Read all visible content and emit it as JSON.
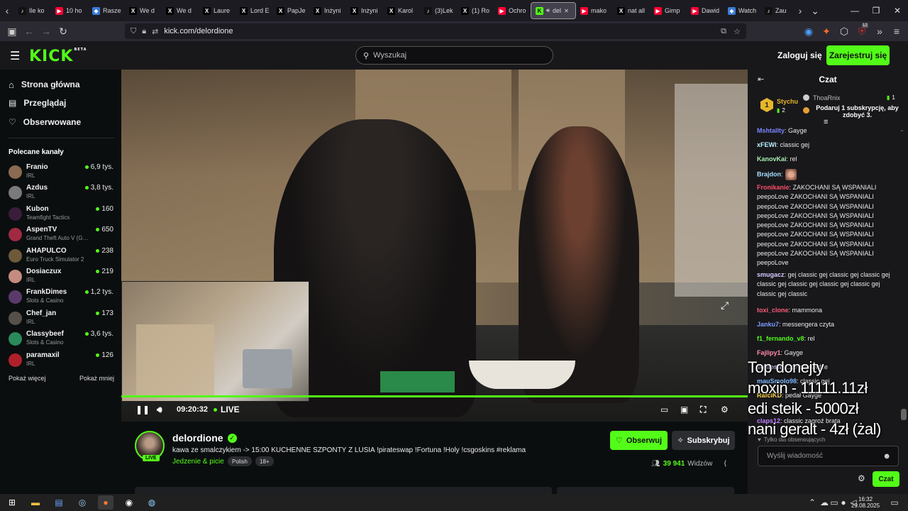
{
  "browser": {
    "tabs": [
      {
        "label": "Ile ko",
        "icon": "tiktok-icon",
        "color": "#111111"
      },
      {
        "label": "10 ho",
        "icon": "youtube-icon",
        "color": "#ff0033"
      },
      {
        "label": "Rasze",
        "icon": "bookmark-icon",
        "color": "#3a7bd5"
      },
      {
        "label": "We d",
        "icon": "x-icon",
        "color": "#000000"
      },
      {
        "label": "We d",
        "icon": "x-icon",
        "color": "#000000"
      },
      {
        "label": "Laure",
        "icon": "x-icon",
        "color": "#000000"
      },
      {
        "label": "Lord E",
        "icon": "x-icon",
        "color": "#000000"
      },
      {
        "label": "PapJe",
        "icon": "x-icon",
        "color": "#000000"
      },
      {
        "label": "Inżyni",
        "icon": "x-icon",
        "color": "#000000"
      },
      {
        "label": "Inżyni",
        "icon": "x-icon",
        "color": "#000000"
      },
      {
        "label": "Karol",
        "icon": "x-icon",
        "color": "#000000"
      },
      {
        "label": "(3)Lek",
        "icon": "tiktok-icon",
        "color": "#111111"
      },
      {
        "label": "(1) Ro",
        "icon": "x-icon",
        "color": "#000000"
      },
      {
        "label": "Ochro",
        "icon": "youtube-icon",
        "color": "#ff0033"
      },
      {
        "label": "del",
        "icon": "kick-icon",
        "color": "#53fc18",
        "active": true
      },
      {
        "label": "mako",
        "icon": "youtube-icon",
        "color": "#ff0033"
      },
      {
        "label": "nat all",
        "icon": "x-icon",
        "color": "#000000"
      },
      {
        "label": "Gimp",
        "icon": "youtube-icon",
        "color": "#ff0033"
      },
      {
        "label": "Dawid",
        "icon": "youtube-icon",
        "color": "#ff0033"
      },
      {
        "label": "Watch",
        "icon": "bookmark-icon",
        "color": "#3a7bd5"
      },
      {
        "label": "Zau",
        "icon": "tiktok-icon",
        "color": "#111111"
      }
    ],
    "url": "kick.com/delordione"
  },
  "header": {
    "logo": "KICK",
    "logo_beta": "BETA",
    "search_placeholder": "Wyszukaj",
    "login": "Zaloguj się",
    "register": "Zarejestruj się"
  },
  "sidebar": {
    "nav": [
      {
        "label": "Strona główna",
        "icon": "home-icon"
      },
      {
        "label": "Przeglądaj",
        "icon": "browse-icon"
      },
      {
        "label": "Obserwowane",
        "icon": "heart-icon"
      }
    ],
    "recommended_title": "Polecane kanały",
    "channels": [
      {
        "name": "Franio",
        "category": "IRL",
        "viewers": "6,9 tys.",
        "color": "#8a6a50"
      },
      {
        "name": "Azdus",
        "category": "IRL",
        "viewers": "3,8 tys.",
        "color": "#7a7a7a"
      },
      {
        "name": "Kubon",
        "category": "Teamfight Tactics",
        "viewers": "160",
        "color": "#3a1d3a"
      },
      {
        "name": "AspenTV",
        "category": "Grand Theft Auto V (G…",
        "viewers": "650",
        "color": "#a02a40"
      },
      {
        "name": "AHAPULCO",
        "category": "Euro Truck Simulator 2",
        "viewers": "238",
        "color": "#6d5a3a"
      },
      {
        "name": "Dosiaczux",
        "category": "IRL",
        "viewers": "219",
        "color": "#c58a80"
      },
      {
        "name": "FrankDimes",
        "category": "Slots & Casino",
        "viewers": "1,2 tys.",
        "color": "#5a3a6a"
      },
      {
        "name": "Chef_jan",
        "category": "IRL",
        "viewers": "173",
        "color": "#55504a"
      },
      {
        "name": "Classybeef",
        "category": "Slots & Casino",
        "viewers": "3,6 tys.",
        "color": "#2a8a5a"
      },
      {
        "name": "paramaxil",
        "category": "IRL",
        "viewers": "126",
        "color": "#b0202a"
      }
    ],
    "show_more": "Pokaż więcej",
    "show_less": "Pokaż mniej"
  },
  "player": {
    "time": "09:20:32",
    "live": "LIVE"
  },
  "stream": {
    "streamer": "delordione",
    "live_badge": "LIVE",
    "title": "kawa ze smalczykiem -> 15:00 KUCHENNE SZPONTY Z LUSIA !pirateswap !Fortuna !Holy !csgoskins  #reklama",
    "category": "Jedzenie & picie",
    "tags": [
      "Polish",
      "18+"
    ],
    "follow": "Obserwuj",
    "subscribe": "Subskrybuj",
    "viewers": "39 941",
    "viewers_label": "Widzów"
  },
  "chat": {
    "title": "Czat",
    "pinned": {
      "rank": "1",
      "user1": "Stychu",
      "user1_count": "2",
      "user2": "ThoaRnix",
      "user2_count": "1",
      "gift_text": "Podaruj 1 subskrypcję, aby zdobyć 3."
    },
    "messages": [
      {
        "user": "Mshtallty",
        "color": "#7a86ff",
        "text": ": Gayge"
      },
      {
        "user": "xFEWI",
        "color": "#b8f0ff",
        "text": ": classic gej"
      },
      {
        "user": "KanovKai",
        "color": "#a8f0b0",
        "text": ": rel"
      },
      {
        "user": "Brajdon",
        "color": "#a8e0ff",
        "text": ":"
      },
      {
        "user": "Fronikanie",
        "color": "#ff4d6a",
        "text": ": ZAKOCHANI SĄ WSPANIALI peepoLove ZAKOCHANI SĄ WSPANIALI peepoLove ZAKOCHANI SĄ WSPANIALI peepoLove ZAKOCHANI SĄ WSPANIALI peepoLove ZAKOCHANI SĄ WSPANIALI peepoLove ZAKOCHANI SĄ WSPANIALI peepoLove ZAKOCHANI SĄ WSPANIALI peepoLove ZAKOCHANI SĄ WSPANIALI peepoLove"
      },
      {
        "user": "smugacz",
        "color": "#d8c8ff",
        "text": ": gej classic gej classic gej classic gej classic gej classic gej classic gej classic gej classic gej classic"
      },
      {
        "user": "toxi_clone",
        "color": "#ff5a7a",
        "text": ": mammona"
      },
      {
        "user": "Janku7",
        "color": "#7a9cff",
        "text": ": messengera czyta"
      },
      {
        "user": "f1_fernando_v8",
        "color": "#53fc18",
        "text": ": rel"
      },
      {
        "user": "Fajlipy1",
        "color": "#ff8aa8",
        "text": ": Gayge"
      },
      {
        "user": "Tomosfi",
        "color": "#c8c8ff",
        "text": ": …c? cojawidze"
      },
      {
        "user": "mauSmolo98",
        "color": "#7ab8ff",
        "text": ": classic gej"
      },
      {
        "user": "RafciKD",
        "color": "#ffd24a",
        "text": ": pedał Gayge"
      },
      {
        "user": "claps12",
        "color": "#c080ff",
        "text": ": classic zagroź brata"
      }
    ],
    "followers_only": "Tylko dla obserwujących",
    "input_placeholder": "Wyślij wiadomość",
    "send": "Czat"
  },
  "overlay": {
    "lines": [
      "Top donejty",
      "moxin - 11111.11zł",
      "edi steik - 5000zł",
      "nani geralt - 4zł (żal)"
    ]
  },
  "taskbar": {
    "time": "16:32",
    "date": "29.08.2025",
    "notification_count": "12"
  }
}
